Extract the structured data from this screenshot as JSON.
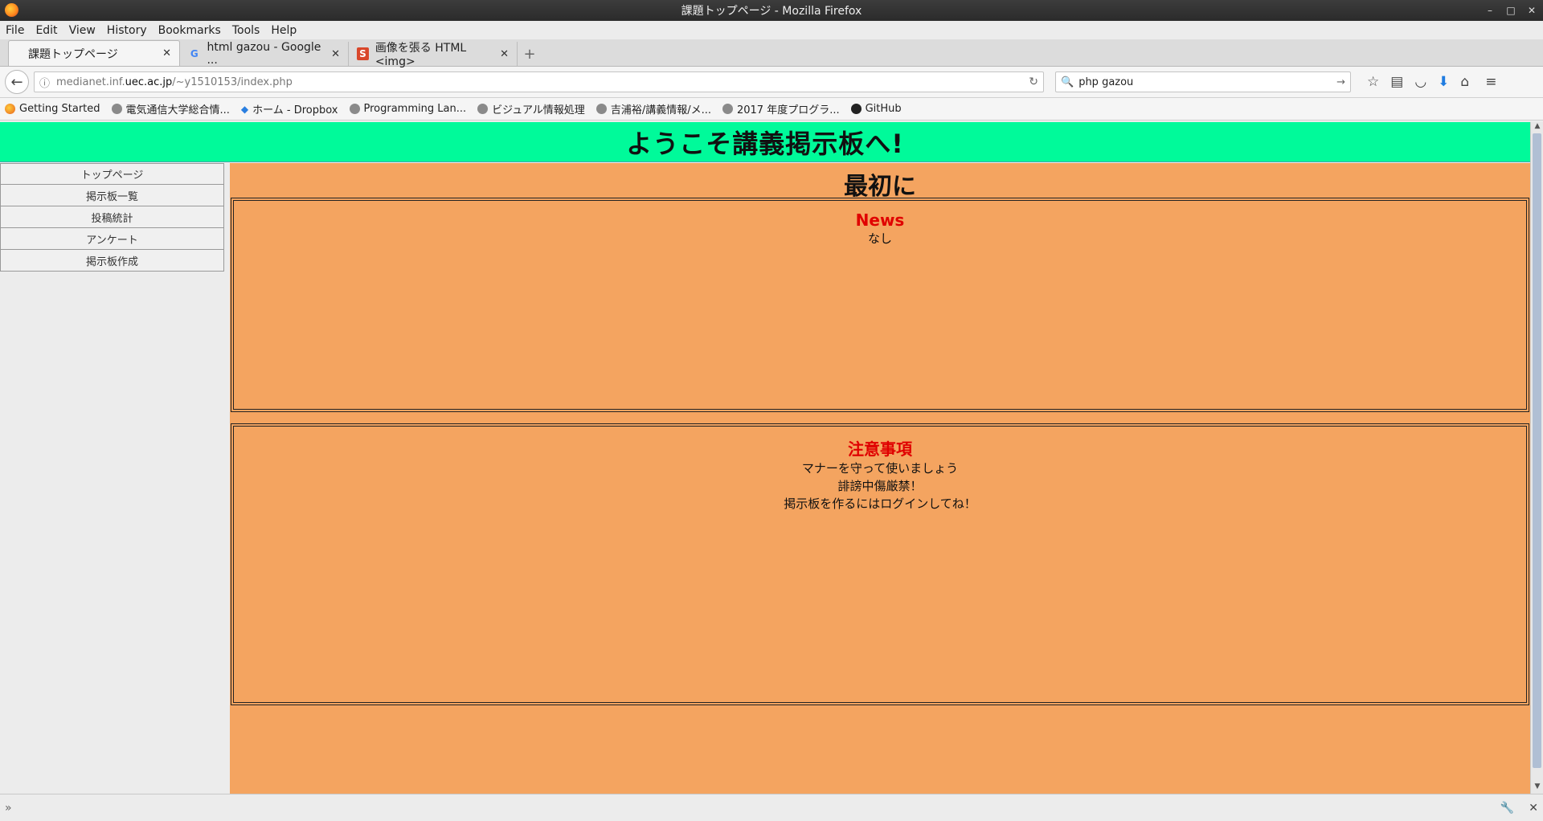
{
  "window": {
    "title": "課題トップページ - Mozilla Firefox"
  },
  "menu": [
    "File",
    "Edit",
    "View",
    "History",
    "Bookmarks",
    "Tools",
    "Help"
  ],
  "tabs": [
    {
      "label": "課題トップページ",
      "active": true
    },
    {
      "label": "html gazou - Google ...",
      "active": false
    },
    {
      "label": "画像を張る HTML <img>",
      "active": false
    }
  ],
  "nav": {
    "url_prefix": "medianet.inf.",
    "url_domain": "uec.ac.jp",
    "url_path": "/~y1510153/index.php",
    "search_value": "php gazou"
  },
  "bookmarks": [
    "Getting Started",
    "電気通信大学総合情...",
    "ホーム - Dropbox",
    "Programming Lan...",
    "ビジュアル情報処理",
    "吉浦裕/講義情報/メ...",
    "2017 年度プログラ...",
    "GitHub"
  ],
  "page": {
    "header": "ようこそ講義掲示板へ!",
    "sidebar": [
      "トップページ",
      "掲示板一覧",
      "投稿統計",
      "アンケート",
      "掲示板作成"
    ],
    "main_title": "最初に",
    "news": {
      "title": "News",
      "lines": [
        "なし"
      ]
    },
    "notes": {
      "title": "注意事項",
      "lines": [
        "マナーを守って使いましょう",
        "誹謗中傷厳禁！",
        "掲示板を作るにはログインしてね！"
      ]
    }
  },
  "colors": {
    "header_bg": "#00fa9a",
    "main_bg": "#f4a460",
    "box_title": "#e00000"
  }
}
